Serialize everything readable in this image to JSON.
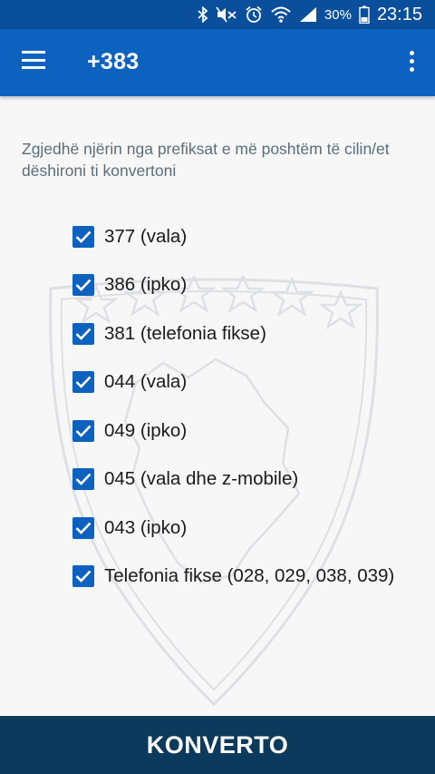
{
  "status_bar": {
    "battery_percent": "30%",
    "time": "23:15"
  },
  "app_bar": {
    "title": "+383"
  },
  "main": {
    "instruction": "Zgjedhë njërin nga prefiksat e më poshtëm të cilin/et dëshironi ti konvertoni",
    "options": [
      {
        "label": "377 (vala)",
        "checked": true
      },
      {
        "label": "386 (ipko)",
        "checked": true
      },
      {
        "label": "381 (telefonia fikse)",
        "checked": true
      },
      {
        "label": "044 (vala)",
        "checked": true
      },
      {
        "label": "049 (ipko)",
        "checked": true
      },
      {
        "label": "045 (vala dhe z-mobile)",
        "checked": true
      },
      {
        "label": "043 (ipko)",
        "checked": true
      },
      {
        "label": "Telefonia fikse (028, 029, 038, 039)",
        "checked": true
      }
    ]
  },
  "footer": {
    "convert_label": "KONVERTO"
  },
  "colors": {
    "status_bar": "#0a4f9b",
    "app_bar": "#0d62c0",
    "checkbox": "#0d62c0",
    "convert_button": "#0c3a5c"
  },
  "icons": [
    "bluetooth-icon",
    "mute-icon",
    "alarm-icon",
    "wifi-icon",
    "signal-icon",
    "battery-icon",
    "menu-icon",
    "overflow-icon",
    "check-icon"
  ]
}
